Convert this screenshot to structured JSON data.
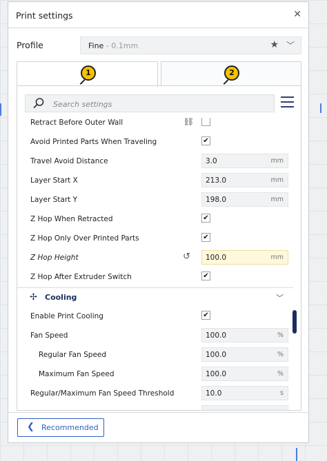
{
  "window": {
    "title": "Print settings",
    "close_glyph": "✕"
  },
  "profile": {
    "label": "Profile",
    "value_main": "Fine",
    "value_sub": " - 0.1mm"
  },
  "tabs": [
    {
      "badge": "1"
    },
    {
      "badge": "2"
    }
  ],
  "search": {
    "placeholder": "Search settings",
    "value": ""
  },
  "settings_rows": [
    {
      "label": "Retract Before Outer Wall",
      "type": "checkbox",
      "checked": false,
      "icon": "link-icon"
    },
    {
      "label": "Avoid Printed Parts When Traveling",
      "type": "checkbox",
      "checked": true
    },
    {
      "label": "Travel Avoid Distance",
      "type": "field",
      "value": "3.0",
      "unit": "mm"
    },
    {
      "label": "Layer Start X",
      "type": "field",
      "value": "213.0",
      "unit": "mm"
    },
    {
      "label": "Layer Start Y",
      "type": "field",
      "value": "198.0",
      "unit": "mm"
    },
    {
      "label": "Z Hop When Retracted",
      "type": "checkbox",
      "checked": true
    },
    {
      "label": "Z Hop Only Over Printed Parts",
      "type": "checkbox",
      "checked": true
    },
    {
      "label": "Z Hop Height",
      "type": "field",
      "value": "100.0",
      "unit": "mm",
      "modified": true,
      "icon": "reset-icon"
    },
    {
      "label": "Z Hop After Extruder Switch",
      "type": "checkbox",
      "checked": true
    }
  ],
  "cooling": {
    "title": "Cooling",
    "rows": [
      {
        "label": "Enable Print Cooling",
        "type": "checkbox",
        "checked": true
      },
      {
        "label": "Fan Speed",
        "type": "field",
        "value": "100.0",
        "unit": "%"
      },
      {
        "label": "Regular Fan Speed",
        "type": "field",
        "value": "100.0",
        "unit": "%",
        "indent": true
      },
      {
        "label": "Maximum Fan Speed",
        "type": "field",
        "value": "100.0",
        "unit": "%",
        "indent": true
      },
      {
        "label": "Regular/Maximum Fan Speed Threshold",
        "type": "field",
        "value": "10.0",
        "unit": "s"
      }
    ]
  },
  "footer": {
    "recommended_label": "Recommended"
  },
  "colors": {
    "accent": "#2e5fc4",
    "navy": "#1b2c5e",
    "badge": "#f5c300",
    "highlight": "#fff8dc"
  }
}
